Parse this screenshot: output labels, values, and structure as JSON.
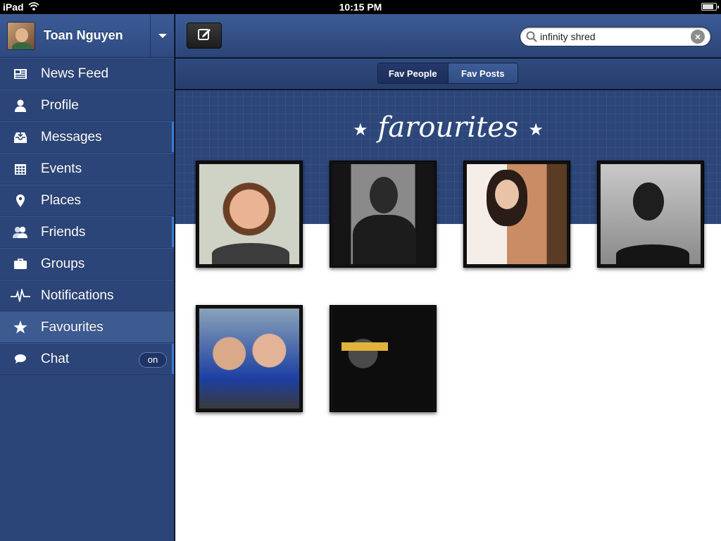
{
  "status_bar": {
    "device": "iPad",
    "time": "10:15 PM",
    "battery_level": 0.9
  },
  "profile": {
    "name": "Toan Nguyen"
  },
  "sidebar": {
    "items": [
      {
        "label": "News Feed",
        "icon": "newspaper-icon",
        "active": false
      },
      {
        "label": "Profile",
        "icon": "person-icon",
        "active": false
      },
      {
        "label": "Messages",
        "icon": "inbox-icon",
        "active": false
      },
      {
        "label": "Events",
        "icon": "calendar-icon",
        "active": false
      },
      {
        "label": "Places",
        "icon": "map-pin-icon",
        "active": false
      },
      {
        "label": "Friends",
        "icon": "people-icon",
        "active": false
      },
      {
        "label": "Groups",
        "icon": "briefcase-icon",
        "active": false
      },
      {
        "label": "Notifications",
        "icon": "pulse-icon",
        "active": false
      },
      {
        "label": "Favourites",
        "icon": "star-icon",
        "active": true
      },
      {
        "label": "Chat",
        "icon": "chat-bubble-icon",
        "active": false,
        "toggle": "on"
      }
    ]
  },
  "toolbar": {
    "search_value": "infinity shred",
    "compose_icon": "compose-icon"
  },
  "tabs": {
    "fav_people": "Fav People",
    "fav_posts": "Fav Posts",
    "selected": "Fav People"
  },
  "main": {
    "title": "farourites"
  },
  "colors": {
    "accent": "#3b7ad6",
    "sidebar_bg": "#2c4578",
    "banner_bg": "#2c4679"
  }
}
